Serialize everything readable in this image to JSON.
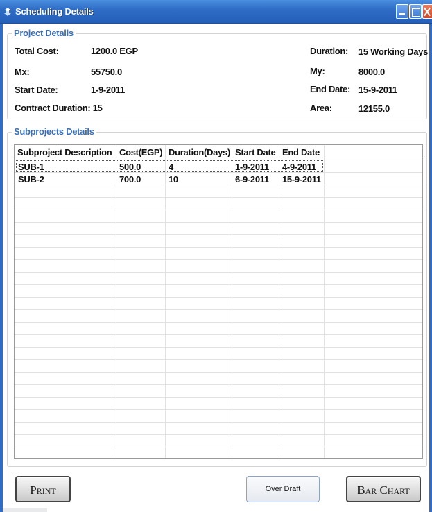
{
  "window": {
    "title": "Scheduling Details",
    "icon": "app-icon"
  },
  "project": {
    "legend": "Project Details",
    "total_cost_label": "Total Cost:",
    "total_cost_value": "1200.0 EGP",
    "mx_label": "Mx:",
    "mx_value": "55750.0",
    "start_date_label": "Start Date:",
    "start_date_value": "1-9-2011",
    "contract_duration": "Contract Duration: 15",
    "duration_label": "Duration:",
    "duration_value": "15 Working Days",
    "my_label": "My:",
    "my_value": "8000.0",
    "end_date_label": "End Date:",
    "end_date_value": "15-9-2011",
    "area_label": "Area:",
    "area_value": "12155.0"
  },
  "subprojects": {
    "legend": "Subprojects Details",
    "columns": [
      "Subproject Description",
      "Cost(EGP)",
      "Duration(Days)",
      "Start Date",
      "End Date"
    ],
    "rows": [
      [
        "SUB-1",
        "500.0",
        "4",
        "1-9-2011",
        "4-9-2011"
      ],
      [
        "SUB-2",
        "700.0",
        "10",
        "6-9-2011",
        "15-9-2011"
      ]
    ]
  },
  "buttons": {
    "print": "Print",
    "over_draft": "Over Draft",
    "bar_chart": "Bar Chart"
  },
  "colors": {
    "titlebar": "#2f6dc6",
    "legend": "#3a6fb8"
  }
}
